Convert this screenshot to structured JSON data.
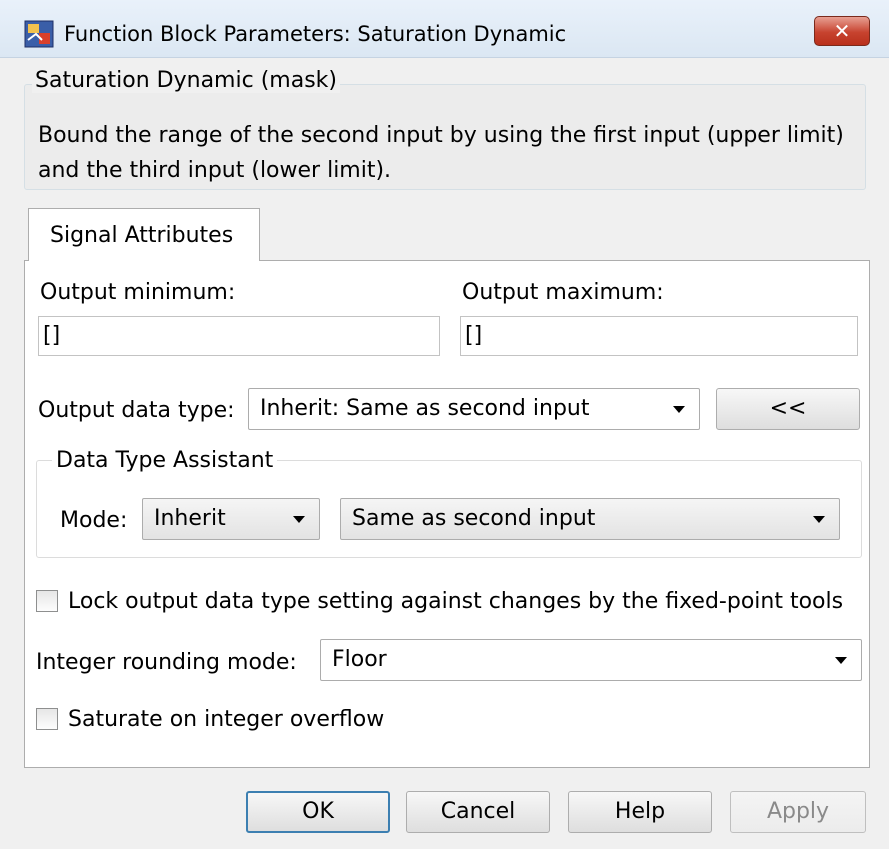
{
  "window": {
    "title": "Function Block Parameters: Saturation Dynamic",
    "close_glyph": "✕"
  },
  "mask": {
    "legend": "Saturation Dynamic (mask)",
    "description": "Bound the range of the second input by using the first input (upper limit) and the third input (lower limit)."
  },
  "tabs": [
    {
      "label": "Signal Attributes",
      "selected": true
    }
  ],
  "output_minimum": {
    "label": "Output minimum:",
    "value": "[]"
  },
  "output_maximum": {
    "label": "Output maximum:",
    "value": "[]"
  },
  "output_data_type": {
    "label": "Output data type:",
    "value": "Inherit: Same as second input",
    "assistant_toggle": "<<"
  },
  "data_type_assistant": {
    "legend": "Data Type Assistant",
    "mode_label": "Mode:",
    "mode_value": "Inherit",
    "inherit_value": "Same as second input"
  },
  "lock_output": {
    "label": "Lock output data type setting against changes by the fixed-point tools",
    "checked": false
  },
  "rounding": {
    "label": "Integer rounding mode:",
    "value": "Floor"
  },
  "saturate": {
    "label": "Saturate on integer overflow",
    "checked": false
  },
  "buttons": {
    "ok": "OK",
    "cancel": "Cancel",
    "help": "Help",
    "apply": "Apply"
  },
  "icons": {
    "app": "simulink-block-icon",
    "close": "close-icon",
    "dropdown": "chevron-down-icon"
  },
  "colors": {
    "close_button": "#c7432f",
    "default_button_border": "#3c7fb1"
  }
}
